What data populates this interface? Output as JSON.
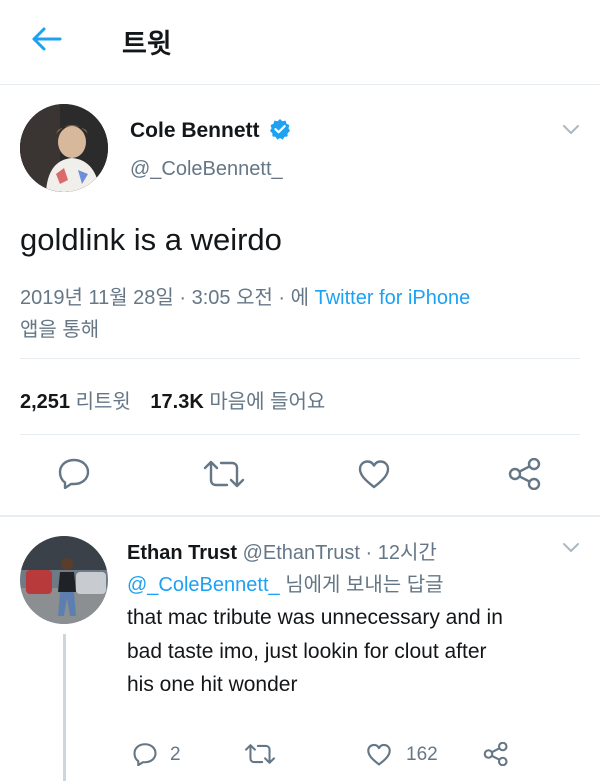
{
  "header": {
    "title": "트윗"
  },
  "tweet": {
    "author_name": "Cole Bennett",
    "author_handle": "@_ColeBennett_",
    "text": "goldlink is a weirdo",
    "timestamp": "2019년 11월 28일 · 3:05 오전 · 에",
    "source": "Twitter for iPhone",
    "source_suffix": "앱을 통해",
    "retweets_count": "2,251",
    "retweets_label": "리트윗",
    "likes_count": "17.3K",
    "likes_label": "마음에 들어요"
  },
  "reply": {
    "author_name": "Ethan Trust",
    "author_handle": "@EthanTrust",
    "time": "· 12시간",
    "reply_to_handle": "@_ColeBennett_",
    "reply_to_suffix": "님에게 보내는 답글",
    "text_line1": "that mac tribute was unnecessary and in",
    "text_line2": "bad taste imo, just lookin for clout after",
    "text_line3": "his one hit wonder",
    "reply_count": "2",
    "like_count": "162"
  },
  "colors": {
    "accent": "#1da1f2",
    "secondary_text": "#657786",
    "divider": "#e6ecf0"
  }
}
